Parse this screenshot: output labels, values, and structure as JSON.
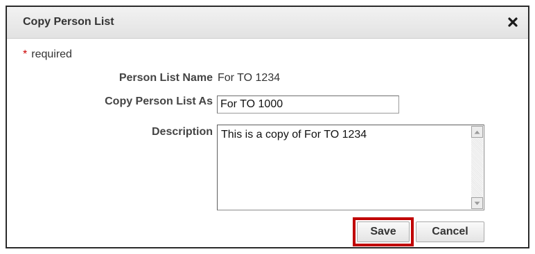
{
  "dialog": {
    "title": "Copy Person List",
    "close_icon": "close-x-icon"
  },
  "form": {
    "required_marker": "*",
    "required_note": "required",
    "person_list_name_label": "Person List Name",
    "person_list_name_value": "For TO 1234",
    "copy_as_label": "Copy Person List As",
    "copy_as_value": "For TO 1000",
    "description_label": "Description",
    "description_value": "This is a copy of For TO 1234"
  },
  "buttons": {
    "save_label": "Save",
    "cancel_label": "Cancel"
  },
  "colors": {
    "highlight": "#c00000",
    "required_asterisk": "#cc0000"
  }
}
